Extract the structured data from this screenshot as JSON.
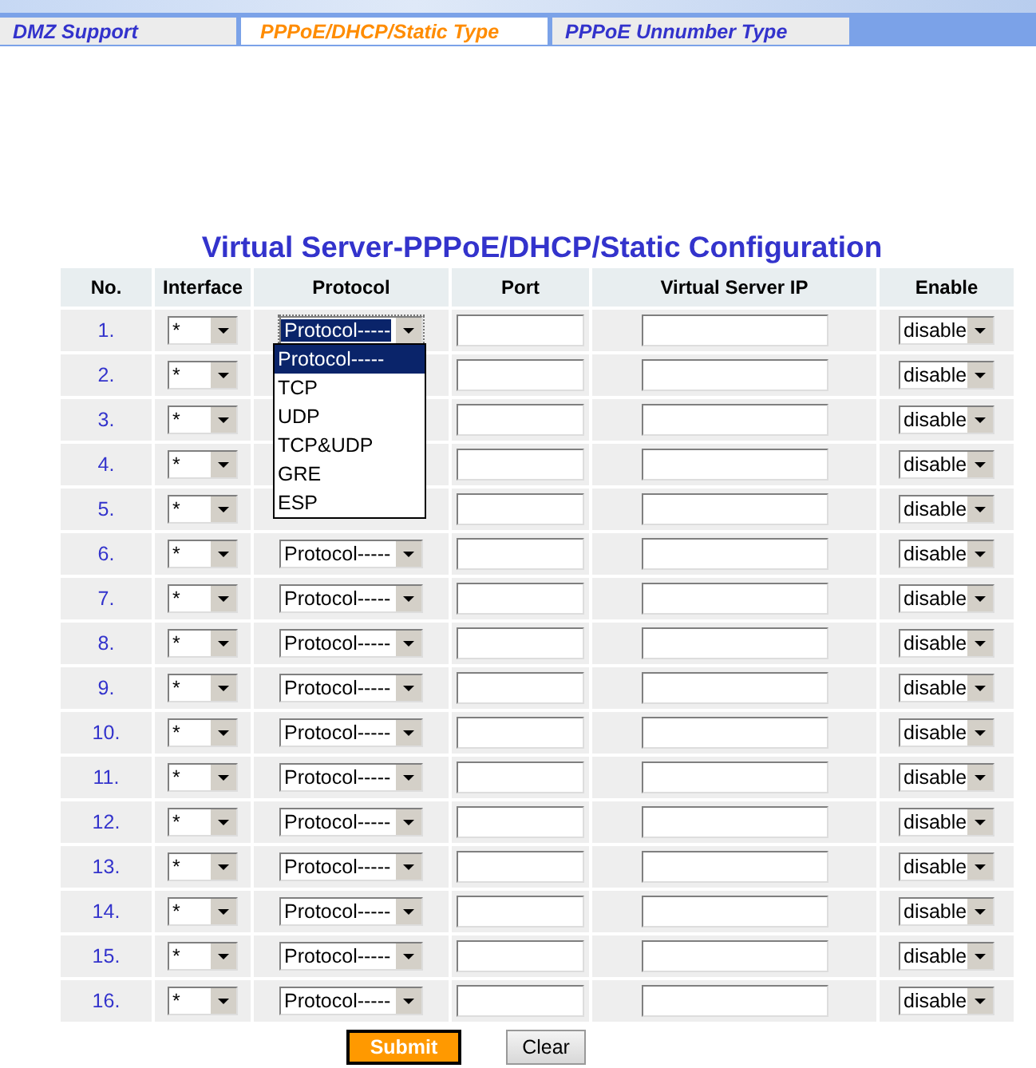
{
  "tabs": [
    {
      "label": "DMZ Support",
      "selected": false
    },
    {
      "label": "PPPoE/DHCP/Static Type",
      "selected": true
    },
    {
      "label": "PPPoE Unnumber Type",
      "selected": false
    }
  ],
  "title": "Virtual Server-PPPoE/DHCP/Static Configuration",
  "columns": [
    "No.",
    "Interface",
    "Protocol",
    "Port",
    "Virtual Server IP",
    "Enable"
  ],
  "rows": [
    {
      "no": "1.",
      "interface": "*",
      "protocol": "Protocol-----",
      "enable": "disable",
      "open": true
    },
    {
      "no": "2.",
      "interface": "*",
      "enable": "disable"
    },
    {
      "no": "3.",
      "interface": "*",
      "enable": "disable"
    },
    {
      "no": "4.",
      "interface": "*",
      "enable": "disable"
    },
    {
      "no": "5.",
      "interface": "*",
      "enable": "disable"
    },
    {
      "no": "6.",
      "interface": "*",
      "protocol": "Protocol-----",
      "enable": "disable"
    },
    {
      "no": "7.",
      "interface": "*",
      "protocol": "Protocol-----",
      "enable": "disable"
    },
    {
      "no": "8.",
      "interface": "*",
      "protocol": "Protocol-----",
      "enable": "disable"
    },
    {
      "no": "9.",
      "interface": "*",
      "protocol": "Protocol-----",
      "enable": "disable"
    },
    {
      "no": "10.",
      "interface": "*",
      "protocol": "Protocol-----",
      "enable": "disable"
    },
    {
      "no": "11.",
      "interface": "*",
      "protocol": "Protocol-----",
      "enable": "disable"
    },
    {
      "no": "12.",
      "interface": "*",
      "protocol": "Protocol-----",
      "enable": "disable"
    },
    {
      "no": "13.",
      "interface": "*",
      "protocol": "Protocol-----",
      "enable": "disable"
    },
    {
      "no": "14.",
      "interface": "*",
      "protocol": "Protocol-----",
      "enable": "disable"
    },
    {
      "no": "15.",
      "interface": "*",
      "protocol": "Protocol-----",
      "enable": "disable"
    },
    {
      "no": "16.",
      "interface": "*",
      "protocol": "Protocol-----",
      "enable": "disable"
    }
  ],
  "protocol_options": [
    {
      "label": "Protocol-----",
      "selected": true
    },
    {
      "label": "TCP",
      "selected": false
    },
    {
      "label": "UDP",
      "selected": false
    },
    {
      "label": "TCP&UDP",
      "selected": false
    },
    {
      "label": "GRE",
      "selected": false
    },
    {
      "label": "ESP",
      "selected": false
    }
  ],
  "buttons": [
    {
      "label": "Submit",
      "kind": "primary"
    },
    {
      "label": "Clear",
      "kind": "secondary"
    }
  ]
}
